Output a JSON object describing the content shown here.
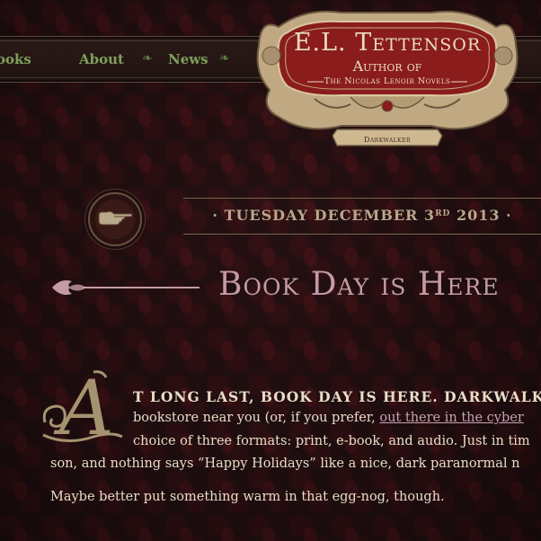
{
  "nav": {
    "items": [
      {
        "label": "ooks"
      },
      {
        "label": "About"
      },
      {
        "label": "News"
      }
    ]
  },
  "crest": {
    "title": "E.L. Tettensor",
    "subtitle": "Author of",
    "series": "The Nicolas Lenoir Novels",
    "ribbon": "Darkwalker"
  },
  "post": {
    "date_day": "· TUESDAY DECEMBER 3",
    "date_suffix": "RD",
    "date_year": "2013 ·",
    "title": "Book Day is Here",
    "dropcap": "A",
    "line1": "T LONG LAST, BOOK DAY IS HERE. DARKWALKE",
    "line2_before": "bookstore near you (or, if you prefer, ",
    "line2_link": "out there in the cyber",
    "line3": "choice of three formats: print, e-book, and audio. Just in tim",
    "line4": "son, and nothing says “Happy Holidays” like a nice, dark paranormal n",
    "line5": "Maybe better put something warm in that egg-nog, though."
  },
  "colors": {
    "background": "#241012",
    "nav_text": "#7fa05a",
    "title_pink": "#c49aa6",
    "crest_red": "#8a1c1c",
    "crest_gold": "#bfa882"
  }
}
